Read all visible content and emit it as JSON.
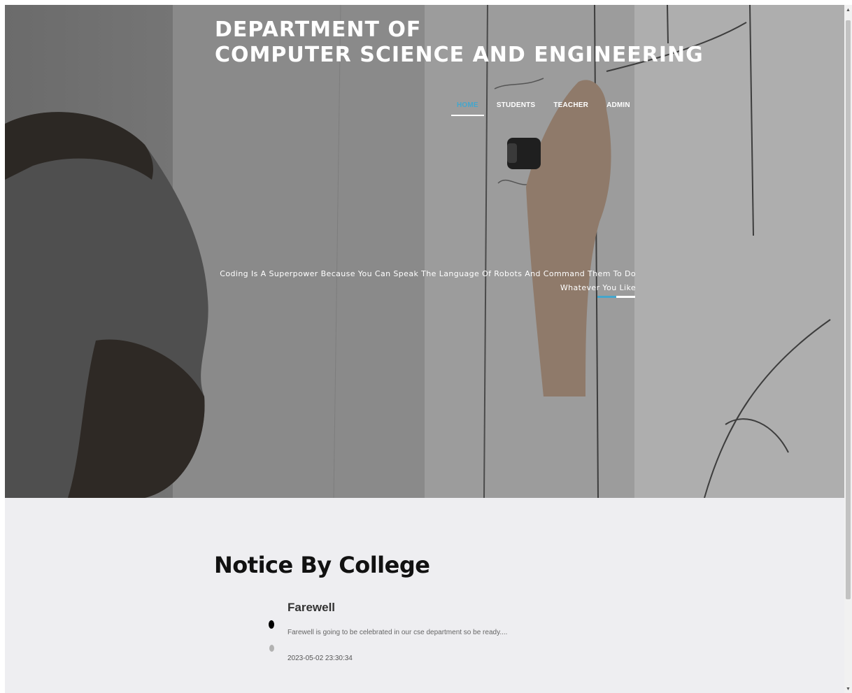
{
  "header": {
    "title_line1": "DEPARTMENT OF",
    "title_line2": "COMPUTER SCIENCE AND ENGINEERING"
  },
  "nav": {
    "items": [
      {
        "label": "HOME",
        "active": true
      },
      {
        "label": "STUDENTS",
        "active": false
      },
      {
        "label": "TEACHER",
        "active": false
      },
      {
        "label": "ADMIN",
        "active": false
      }
    ]
  },
  "hero": {
    "quote": "Coding Is A Superpower Because You Can Speak The Language Of Robots And Command Them To Do Whatever You Like",
    "slider_progress": 0.5
  },
  "notice": {
    "heading": "Notice By College",
    "items": [
      {
        "title": "Farewell",
        "body": "Farewell is going to be celebrated in our cse department so be ready....",
        "date": "2023-05-02 23:30:34"
      }
    ],
    "pagination": {
      "count": 2,
      "current": 1
    }
  },
  "colors": {
    "accent": "#45a6cc",
    "page_background": "#eeeef1",
    "heading": "#111111"
  },
  "icons": {
    "scroll_up": "triangle-up-icon",
    "scroll_down": "triangle-down-icon"
  }
}
